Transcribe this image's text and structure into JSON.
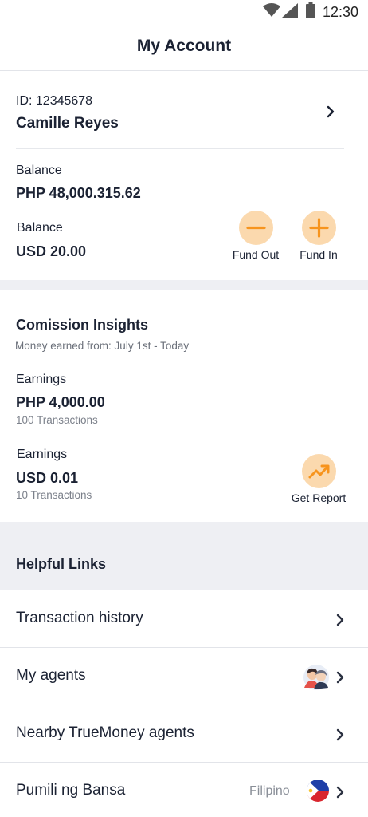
{
  "status_bar": {
    "time": "12:30",
    "icons": [
      "wifi-icon",
      "signal-icon",
      "battery-icon"
    ]
  },
  "header": {
    "title": "My Account"
  },
  "profile": {
    "id_text": "ID: 12345678",
    "name": "Camille Reyes"
  },
  "balances": [
    {
      "label": "Balance",
      "amount": "PHP 48,000.315.62"
    },
    {
      "label": "Balance",
      "amount": "USD 20.00"
    }
  ],
  "actions": {
    "fund_out": "Fund Out",
    "fund_in": "Fund In"
  },
  "commission": {
    "title": "Comission Insights",
    "subtitle": "Money earned from: July 1st - Today",
    "earnings": [
      {
        "label": "Earnings",
        "amount": "PHP 4,000.00",
        "transactions": "100 Transactions"
      },
      {
        "label": "Earnings",
        "amount": "USD 0.01",
        "transactions": "10 Transactions"
      }
    ],
    "get_report": "Get Report"
  },
  "helpful_links": {
    "title": "Helpful Links",
    "items": [
      {
        "label": "Transaction history"
      },
      {
        "label": "My agents"
      },
      {
        "label": "Nearby TrueMoney agents"
      },
      {
        "label": "Pumili ng Bansa",
        "value": "Filipino"
      }
    ]
  },
  "colors": {
    "accent": "#f7941d",
    "accent_bg": "#fbd9ae",
    "text": "#1b2233",
    "muted": "#7c818b",
    "band": "#eeeff3"
  }
}
